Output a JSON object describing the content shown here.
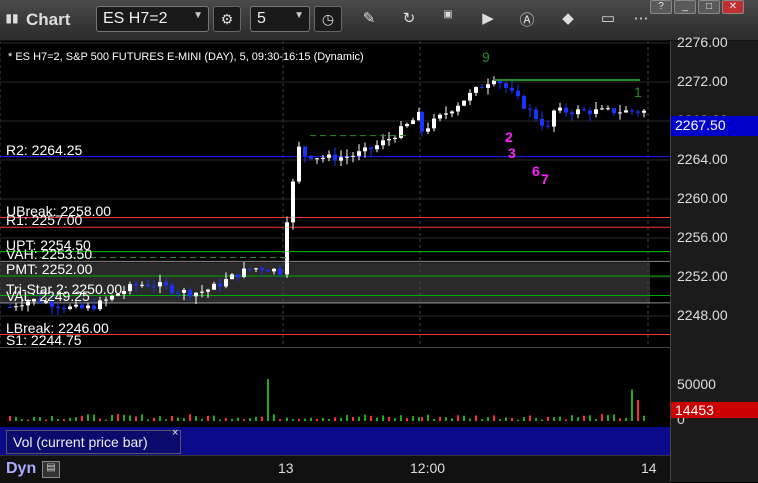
{
  "toolbar": {
    "title": "Chart",
    "symbol": "ES H7=2",
    "interval": "5"
  },
  "chart_header": "* ES H7=2, S&P 500 FUTURES E-MINI (DAY), 5, 09:30-16:15 (Dynamic)",
  "price_ticks": [
    "2276.00",
    "2272.00",
    "2268.00",
    "2264.00",
    "2260.00",
    "2256.00",
    "2252.00",
    "2248.00"
  ],
  "current_price": "2267.50",
  "levels": [
    {
      "label": "R2: 2264.25",
      "color": "#1a1aff"
    },
    {
      "label": "UBreak: 2258.00",
      "color": "#ff3030"
    },
    {
      "label": "R1: 2257.00",
      "color": "#ff3030"
    },
    {
      "label": "UPT: 2254.50",
      "color": "#00cc00"
    },
    {
      "label": "VAH: 2253.50",
      "color": "#888888"
    },
    {
      "label": "PMT: 2252.00",
      "color": "#00aa00"
    },
    {
      "label": "Tri-Star 2: 2250.00",
      "color": "#00aa00"
    },
    {
      "label": "VAL: 2249.25",
      "color": "#888888"
    },
    {
      "label": "LBreak: 2246.00",
      "color": "#ff3030"
    },
    {
      "label": "S1: 2244.75",
      "color": "#ff3030"
    }
  ],
  "volume": {
    "panel_label": "Vol (current price bar)",
    "ticks": [
      "50000",
      "0"
    ],
    "current": "14453"
  },
  "time_ticks": [
    "13",
    "12:00",
    "14"
  ],
  "bottom": {
    "label": "Dyn"
  },
  "annotations": {
    "green": [
      "9",
      "1"
    ],
    "magenta": [
      "2",
      "3",
      "6",
      "7"
    ]
  },
  "colors": {
    "up": "#ffffff",
    "down": "#1a33ff",
    "accent": "#0000cc"
  }
}
